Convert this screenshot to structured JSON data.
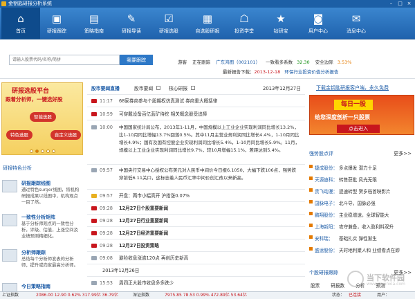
{
  "window": {
    "title": "金钥匙研报分析系统"
  },
  "toolbar": {
    "items": [
      {
        "label": "首页",
        "icon": "home-icon"
      },
      {
        "label": "研报跟踪",
        "icon": "monitor-icon"
      },
      {
        "label": "策略指南",
        "icon": "chart-icon"
      },
      {
        "label": "研报导读",
        "icon": "edit-icon"
      },
      {
        "label": "研报选股",
        "icon": "check-icon"
      },
      {
        "label": "自选股研报",
        "icon": "table-icon"
      },
      {
        "label": "投资学堂",
        "icon": "classroom-icon"
      },
      {
        "label": "钻研宝",
        "icon": "star-icon"
      },
      {
        "label": "用户中心",
        "icon": "user-icon"
      },
      {
        "label": "消息中心",
        "icon": "message-icon"
      }
    ]
  },
  "search": {
    "placeholder": "请输入股票代码/名称/简拼",
    "button": "我要跟踪"
  },
  "status": {
    "a": "游客",
    "b": "正在跟踪",
    "c": "广东鸿图（002101）",
    "d": "一致看多系数",
    "d_val": "32.30",
    "e": "安全边际",
    "e_val": "3.53%",
    "latest_label": "最新报告下载：",
    "latest_date": "2013-12-18",
    "latest_text": "环保行业投资价值分析报告"
  },
  "left": {
    "banner": {
      "title": "研报选股平台",
      "subtitle": "跟着分析师，一键选好股",
      "btn1": "智能选股",
      "btn2": "特色选股",
      "btn3": "自定义选股"
    },
    "section_title": "研报特色分析",
    "features": [
      {
        "title": "研报跟踪线图",
        "desc": "通过特色surger线图，将机构研报成果以线图中，机构观点一目了然。"
      },
      {
        "title": "一致性分析矩阵",
        "desc": "基于分析师观点的一致性分析，评级、估值，上涨空间及业绩预测精细化。"
      },
      {
        "title": "分析师跟踪",
        "desc": "总结每个分析师发表的分析师，提升或向家最高分析师。"
      },
      {
        "title": "今日策略指南",
        "desc": ""
      }
    ]
  },
  "center": {
    "tab_main": "股市要闻直播",
    "tab_a": "股市要闻",
    "tab_b": "核心研报",
    "date": "2013年12月27日",
    "rows": [
      {
        "time": "11:17",
        "text": "68家券商参与个股期权仿真测试 券商重大概括律"
      },
      {
        "time": "10:59",
        "text": "可穿戴设备百亿蓝矿待挖 相关概念股受追捧"
      },
      {
        "time": "10:00",
        "text": "中国国家统计局公布，2013年1-11月，中国规模以上工业企业实现利润同比增长13.2%，比1-10月同比增幅13.7%回落0.5%。其中11月主营业务利润同比增长4.4%，1-10月同比增长4.9%；国有及国有控股企业实现利润同比增长5.4%，1-10月同比增长5.9%。11月，规模以上工业企业实现利润同比增长9.7%，较10月增幅15.1%，差距达到5.4%。"
      },
      {
        "time": "09:57",
        "text": "中国央行交易中心授权公布美元对人民币中间价今日报6.1050，大幅下跌106点，强势跌穿前低6.11关口，这标志着人民币汇率中间价创汇改以来新高。"
      },
      {
        "time": "09:57",
        "text": "开盘：两市小幅高开 沪指涨0.07%"
      },
      {
        "time": "09:28",
        "text": "12月27日个股重要新闻"
      },
      {
        "time": "09:28",
        "text": "12月27日行业重要新闻"
      },
      {
        "time": "09:28",
        "text": "12月27日经济重要新闻"
      },
      {
        "time": "09:28",
        "text": "12月27日投资策略"
      },
      {
        "time": "09:08",
        "text": "避险收盘涨逾120点 再创历史新高"
      },
      {
        "time": "",
        "text": "2013年12月26日"
      },
      {
        "time": "15:53",
        "text": "周四正大股市收盘多多跌少"
      }
    ]
  },
  "right": {
    "link": "下载金钥匙研报客户端，永久免费",
    "banner": {
      "t1": "每日一股",
      "t2": "给您深度剖析一只股票",
      "t3": "点击进入"
    },
    "section1": "强势股点评",
    "more": "更多>>",
    "items": [
      {
        "a": "捷成股份：",
        "c": "多点爆发  潜力十足"
      },
      {
        "a": "天源迪科：",
        "c": "转售获批  风光无限"
      },
      {
        "a": "贵飞动漫：",
        "c": "提速转型  贺岁档首映影片"
      },
      {
        "a": "国脉电子：",
        "c": "北斗导，国脉必强"
      },
      {
        "a": "鹏翔股份：",
        "c": "主业稳增速，全球智能大"
      },
      {
        "a": "上海新阳：",
        "c": "攻守兼备，收入盈利料双升"
      },
      {
        "a": "安科瑞：",
        "c": "基础扎实  弹性渐生"
      },
      {
        "a": "盛运股份：",
        "c": "天时地利聚人和  业绩看点在即"
      }
    ],
    "section2": "个股研报跟踪",
    "more2": "更多>>",
    "tabs": [
      "股票",
      "研报数",
      "分析",
      "预测"
    ]
  },
  "statusbar": {
    "sh_label": "上证指数",
    "sh": "2086.00  12.90  0.62%  317.99亿  36.79亿",
    "sz_label": "深证指数",
    "sz": "7975.85  78.53  0.99%  472.89亿  53.64亿",
    "state": "状态：",
    "state_val": "已连接",
    "user": "用户："
  },
  "watermark": {
    "cn": "当下软件园",
    "url": "www.downxia.com"
  },
  "colors": {
    "accent": "#1f62ad",
    "red": "#c8161d",
    "orange": "#e47a00",
    "green": "#0a8a0a"
  }
}
